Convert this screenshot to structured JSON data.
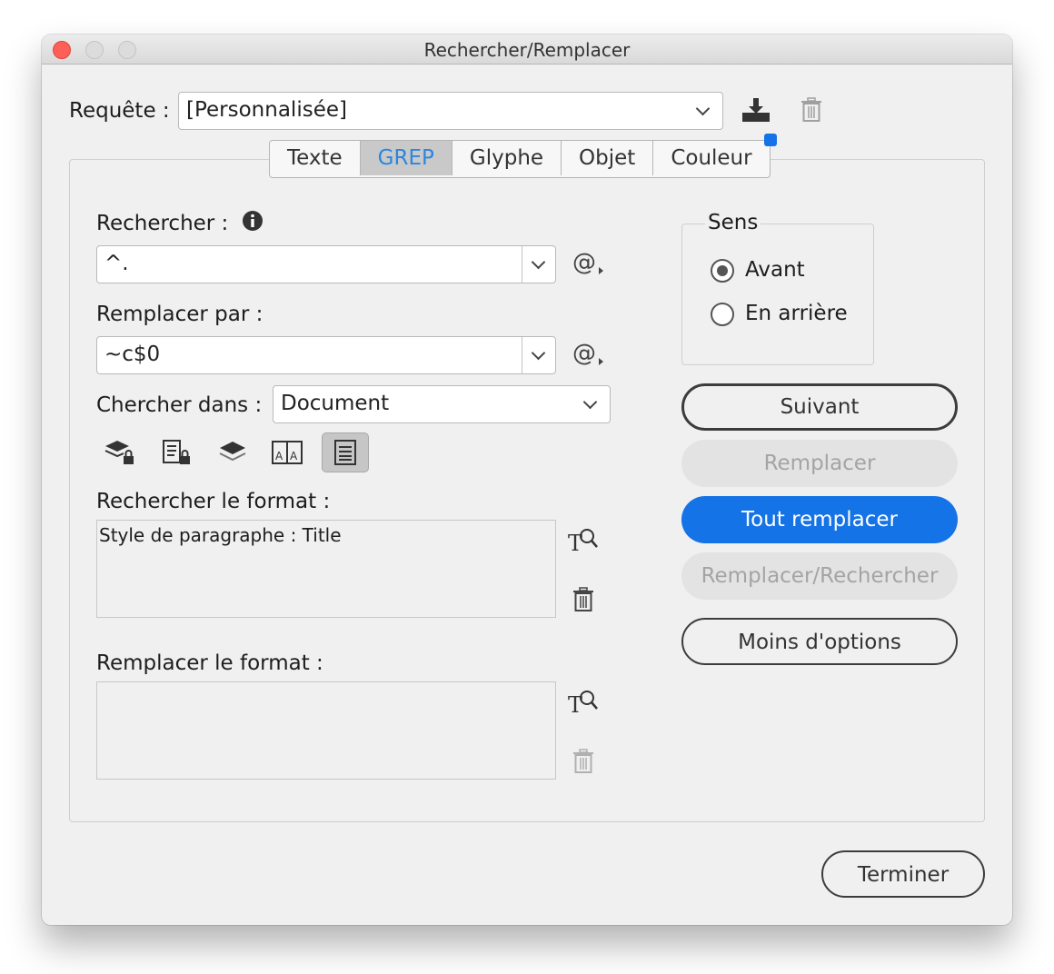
{
  "window": {
    "title": "Rechercher/Remplacer"
  },
  "query": {
    "label": "Requête :",
    "value": "[Personnalisée]"
  },
  "tabs": [
    {
      "label": "Texte",
      "active": false
    },
    {
      "label": "GREP",
      "active": true
    },
    {
      "label": "Glyphe",
      "active": false
    },
    {
      "label": "Objet",
      "active": false
    },
    {
      "label": "Couleur",
      "active": false
    }
  ],
  "find": {
    "label": "Rechercher :",
    "value": "^."
  },
  "replace": {
    "label": "Remplacer par :",
    "value": "~c$0"
  },
  "search_in": {
    "label": "Chercher dans :",
    "value": "Document"
  },
  "find_format": {
    "label": "Rechercher le format :",
    "value": "Style de paragraphe : Title"
  },
  "replace_format": {
    "label": "Remplacer le format :",
    "value": ""
  },
  "direction": {
    "title": "Sens",
    "options": [
      {
        "label": "Avant",
        "selected": true
      },
      {
        "label": "En arrière",
        "selected": false
      }
    ]
  },
  "buttons": {
    "next": "Suivant",
    "replace": "Remplacer",
    "replace_all": "Tout remplacer",
    "replace_find": "Remplacer/Rechercher",
    "fewer_options": "Moins d'options",
    "done": "Terminer"
  },
  "special_char_symbol": "@",
  "colors": {
    "accent": "#1473e6",
    "active_tab_text": "#2a86e0",
    "close": "#fe5f57"
  },
  "icons": [
    "save-query-icon",
    "delete-query-icon",
    "info-icon",
    "special-characters-icon",
    "include-locked-layers-icon",
    "include-locked-stories-icon",
    "include-hidden-layers-icon",
    "include-master-pages-icon",
    "include-footnotes-icon",
    "specify-format-icon",
    "clear-format-icon"
  ]
}
